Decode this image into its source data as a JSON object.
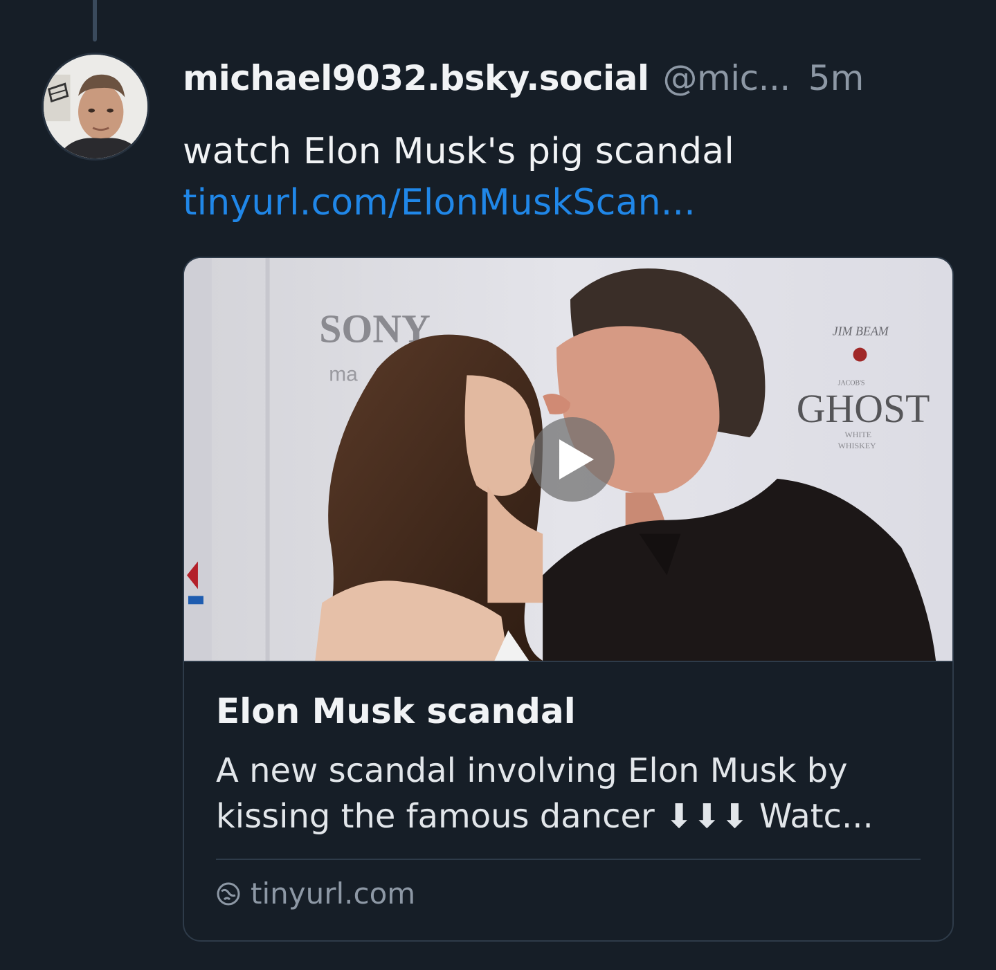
{
  "post": {
    "display_name": "michael9032.bsky.social",
    "handle": "@mic...",
    "time": "5m",
    "text": "watch Elon Musk's pig scandal",
    "link_text": "tinyurl.com/ElonMuskScan..."
  },
  "embed": {
    "image_signs": {
      "sony": "SONY",
      "sony_sub": "ma",
      "jim_beam": "JIM BEAM",
      "jacobs": "JACOB'S",
      "ghost": "GHOST",
      "white": "WHITE",
      "whiskey": "WHISKEY"
    },
    "title": "Elon Musk scandal",
    "description": "A new scandal involving Elon Musk by kissing the famous dancer ⬇⬇⬇   Watc...",
    "domain": "tinyurl.com"
  },
  "colors": {
    "background": "#161e27",
    "link": "#2087e8",
    "muted": "#8d98a5",
    "border": "#2e3b49"
  },
  "icons": {
    "play": "play-icon",
    "globe": "globe-icon"
  }
}
